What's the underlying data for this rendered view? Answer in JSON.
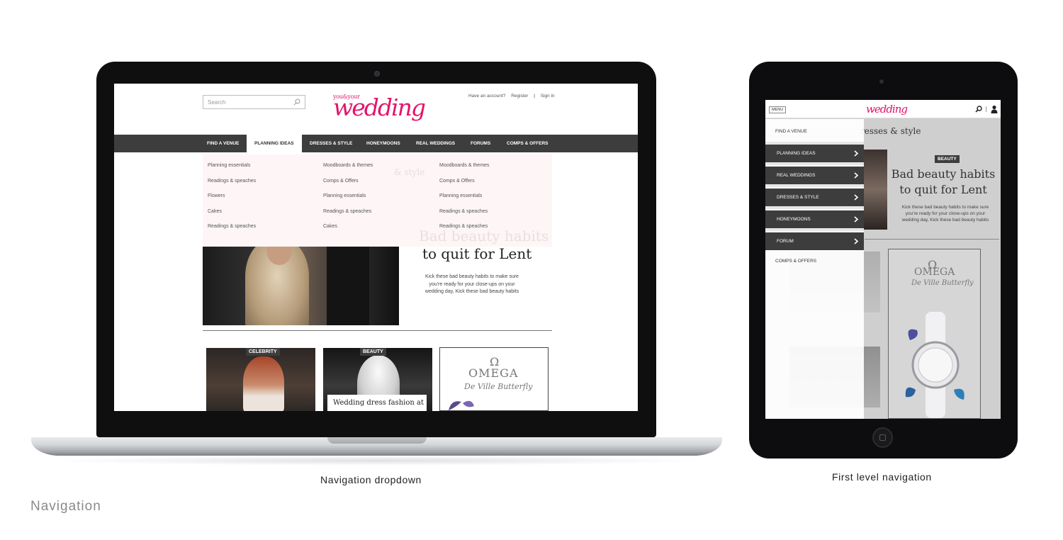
{
  "laptop_site": {
    "search_placeholder": "Search",
    "logo_small": "you&your",
    "logo_big": "wedding",
    "account": {
      "have_account": "Have an account?",
      "register": "Register",
      "separator": "|",
      "sign_in": "Sign in"
    },
    "nav": [
      "FIND A VENUE",
      "PLANNING IDEAS",
      "DRESSES & STYLE",
      "HONEYMOONS",
      "REAL WEDDINGS",
      "FORUMS",
      "COMPS & OFFERS"
    ],
    "nav_active": "PLANNING IDEAS",
    "dropdown": {
      "col1": [
        "Planning essentials",
        "Readings & speaches",
        "Flowers",
        "Cakes",
        "Readings & speaches"
      ],
      "col2": [
        "Moodboards & themes",
        "Comps & Offers",
        "Planning essentials",
        "Readings & speaches",
        "Cakes"
      ],
      "col3": [
        "Moodboards & themes",
        "Comps & Offers",
        "Planning essentials",
        "Readings & speaches",
        "Readings & speaches"
      ],
      "ghost_title": "& style",
      "ghost_headline": "Bad beauty habits"
    },
    "hero": {
      "headline": "to quit for Lent",
      "description": "Kick these bad beauty habits to make sure you're ready for your close-ups on your wedding day, Kick these bad beauty habits"
    },
    "cards": [
      {
        "tag": "CELEBRITY"
      },
      {
        "tag": "BEAUTY",
        "caption": "Wedding dress fashion at"
      }
    ],
    "ad": {
      "symbol": "Ω",
      "brand": "OMEGA",
      "sub": "De Ville Butterfly"
    }
  },
  "tablet_site": {
    "menu_label": "MENU",
    "logo": "wedding",
    "under_title": "resses & style",
    "beauty_tag": "BEAUTY",
    "headline": "Bad beauty habits to quit for Lent",
    "description": "Kick these bad beauty habits to make sure you're ready for your close-ups on your wedding day, Kick these bad beauty habits",
    "ad": {
      "symbol": "Ω",
      "brand": "OMEGA",
      "sub": "De Ville Butterfly"
    },
    "drawer": {
      "first": "FIND A VENUE",
      "dark_items": [
        "PLANNING IDEAS",
        "REAL WEDDINGS",
        "DRESSES & STYLE",
        "HONEYMOONS",
        "FORUM"
      ],
      "last": "COMPS & OFFERS"
    }
  },
  "captions": {
    "laptop": "Navigation dropdown",
    "tablet": "First level navigation",
    "section": "Navigation"
  },
  "colors": {
    "brand_pink": "#e2156b",
    "nav_dark": "#3d3d3d",
    "dropdown_bg": "#fdf4f5"
  }
}
